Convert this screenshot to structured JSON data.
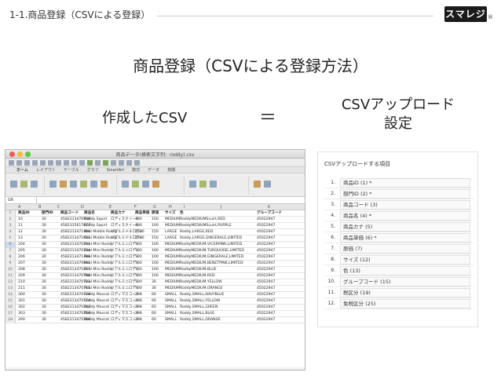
{
  "header": {
    "title": "1-1.商品登録（CSVによる登録）",
    "logo": "スマレジ",
    "logo_mark": "®"
  },
  "slide": {
    "title": "商品登録（CSVによる登録方法）",
    "left_label": "作成したCSV",
    "equals": "＝",
    "right_label_line1": "CSVアップロード",
    "right_label_line2": "設定"
  },
  "spreadsheet": {
    "window_title": "商品データ(検索文字列：roddy).csv",
    "ribbon_tabs": [
      "ホーム",
      "レイアウト",
      "テーブル",
      "グラフ",
      "SmartArt",
      "数式",
      "データ",
      "校閲"
    ],
    "name_box": "G6",
    "column_letters": [
      "A",
      "B",
      "C",
      "D",
      "E",
      "F",
      "G",
      "H",
      "I",
      "J",
      "K"
    ],
    "headers": [
      "商品ID",
      "部門ID",
      "商品コード",
      "商品名",
      "商品カナ",
      "商品単価",
      "原価",
      "サイズ",
      "色",
      "グループコード"
    ],
    "rows": [
      [
        "10",
        "30",
        "4582213470938",
        "Roddy Squirt",
        "ロディスクイート",
        "400",
        "100",
        "MEDIUM",
        "RoddyMEDIUMScuirt,RED",
        "45022947"
      ],
      [
        "11",
        "30",
        "4582315617677",
        "Roddy Squirt",
        "ロディスクイート",
        "400",
        "100",
        "MEDIUM",
        "RoddyMEDIUMScuirt,PURPLE",
        "45022947"
      ],
      [
        "12",
        "30",
        "4582213471406",
        "Real Middle Roddy",
        "リアルミドルロディ",
        "1500",
        "150",
        "LARGE",
        "Roddy,LARGE,RED",
        "45022947"
      ],
      [
        "13",
        "30",
        "4582213471031",
        "Real Middle Roddy",
        "リアルミドルロディ",
        "1500",
        "150",
        "LARGE",
        "Roddy,LARGE,GINGERALE,LIMITED",
        "45022947"
      ],
      [
        "204",
        "30",
        "4582213470231",
        "Real Mini Roddy",
        "リアルミニロディ",
        "700",
        "100",
        "MEDIUM",
        "RoddyMEDIUM,VICERPINK,LIMITED",
        "45022947"
      ],
      [
        "205",
        "30",
        "4582213470234",
        "Real Mini Roddy",
        "リアルミニロディ",
        "700",
        "100",
        "MEDIUM",
        "RoddyMEDIUM,TURQUOISE,LIMITED",
        "45022947"
      ],
      [
        "206",
        "30",
        "4582213471396",
        "Real Mini Roddy",
        "リアルミニロディ",
        "700",
        "100",
        "MEDIUM",
        "RoddyMEDIUM,GINGERALE,LIMITED",
        "45022947"
      ],
      [
        "207",
        "30",
        "4582213470641",
        "Real Mini Roddy",
        "リアルミニロディ",
        "700",
        "100",
        "MEDIUM",
        "RoddyMEDIUM,BENETPINK,LIMITED",
        "45022947"
      ],
      [
        "208",
        "30",
        "4582213470227",
        "Real Mini Roddy",
        "リアルミニロディ",
        "700",
        "100",
        "MEDIUM",
        "RoddyMEDIUM,BLUE",
        "45022947"
      ],
      [
        "209",
        "30",
        "4582213470708",
        "Real Mini Roddy",
        "リアルミニロディ",
        "700",
        "100",
        "MEDIUM",
        "RoddyMEDIUM,RED",
        "45022947"
      ],
      [
        "210",
        "30",
        "4582213470723",
        "Real Mini Roddy",
        "リアルミニロディ",
        "700",
        "30",
        "MEDIUM",
        "RoddyMEDIUM,YELLOW",
        "45022947"
      ],
      [
        "211",
        "30",
        "4582213470715",
        "Real Mini Roddy",
        "リアルミニロディ",
        "700",
        "30",
        "MEDIUM",
        "RoddyMEDIUM,ORANGE",
        "45022947"
      ],
      [
        "300",
        "30",
        "4582213470129",
        "Roddy Mascot",
        "ロディマスコット",
        "298",
        "60",
        "SMALL",
        "Roddy,SMALL,NAVYBLUE",
        "45022947"
      ],
      [
        "301",
        "30",
        "4582213470174",
        "Roddy Mascot",
        "ロディマスコット",
        "298",
        "60",
        "SMALL",
        "Roddy,SMALL,YELLOW",
        "45022947"
      ],
      [
        "302",
        "30",
        "4582213470242",
        "Roddy Mascot",
        "ロディマスコット",
        "298",
        "60",
        "SMALL",
        "Roddy,SMALL,GREEN",
        "45022947"
      ],
      [
        "303",
        "30",
        "4582213470259",
        "Roddy Mascot",
        "ロディマスコット",
        "298",
        "60",
        "SMALL",
        "Roddy,SMALL,BLUE",
        "45022947"
      ],
      [
        "290",
        "30",
        "4582213470266",
        "Roddy Mascot",
        "ロディマスコット",
        "298",
        "60",
        "SMALL",
        "Roddy,SMALL,ORANGE",
        "45022947"
      ]
    ]
  },
  "csv_panel": {
    "title": "CSVアップロードする項目",
    "items": [
      {
        "num": "1.",
        "label": "商品ID (1) *"
      },
      {
        "num": "2.",
        "label": "部門ID (2) *"
      },
      {
        "num": "3.",
        "label": "商品コード (3)"
      },
      {
        "num": "4.",
        "label": "商品名 (4) *"
      },
      {
        "num": "5.",
        "label": "商品カナ (5)"
      },
      {
        "num": "6.",
        "label": "商品単価 (6) *"
      },
      {
        "num": "7.",
        "label": "原価 (7)"
      },
      {
        "num": "8.",
        "label": "サイズ (12)"
      },
      {
        "num": "9.",
        "label": "色 (13)"
      },
      {
        "num": "10.",
        "label": "グループコード (15)"
      },
      {
        "num": "11.",
        "label": "税区分 (19)"
      },
      {
        "num": "12.",
        "label": "免税区分 (25)"
      }
    ]
  }
}
